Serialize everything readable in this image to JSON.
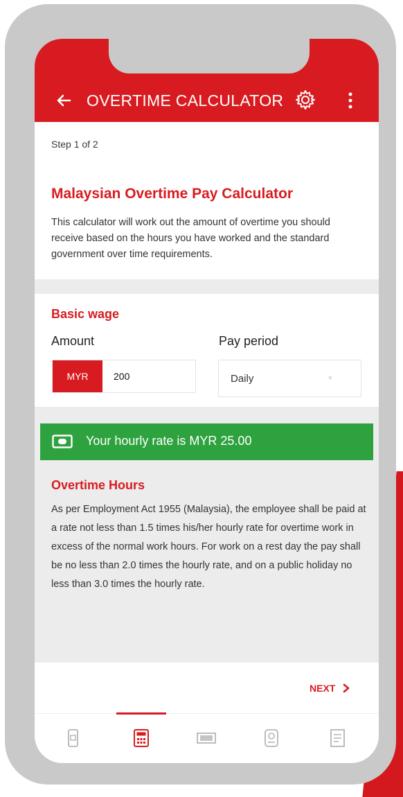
{
  "header": {
    "title": "OVERTIME CALCULATOR"
  },
  "intro": {
    "step": "Step 1 of 2",
    "title": "Malaysian Overtime Pay Calculator",
    "description": "This calculator will work out the amount of overtime you should receive based on the hours you have worked and the standard government over time requirements."
  },
  "basic_wage": {
    "title": "Basic wage",
    "amount_label": "Amount",
    "currency": "MYR",
    "amount_value": "200",
    "period_label": "Pay period",
    "period_value": "Daily"
  },
  "hourly_rate": {
    "text": "Your hourly rate is MYR 25.00"
  },
  "overtime": {
    "title": "Overtime Hours",
    "text": "As per Employment Act 1955 (Malaysia), the employee shall be paid at a rate not less than 1.5 times his/her hourly rate for overtime work in excess of the normal work hours. For work on a rest day the pay shall be no less than 2.0 times the hourly rate, and on a public holiday no less than 3.0 times the hourly rate."
  },
  "footer": {
    "next_label": "NEXT"
  },
  "nav": {
    "items": [
      "phone-icon",
      "calculator-icon",
      "cash-icon",
      "badge-icon",
      "document-icon"
    ],
    "active": "calculator-icon"
  },
  "colors": {
    "brand_red": "#d81b20",
    "success_green": "#2ea23e"
  }
}
